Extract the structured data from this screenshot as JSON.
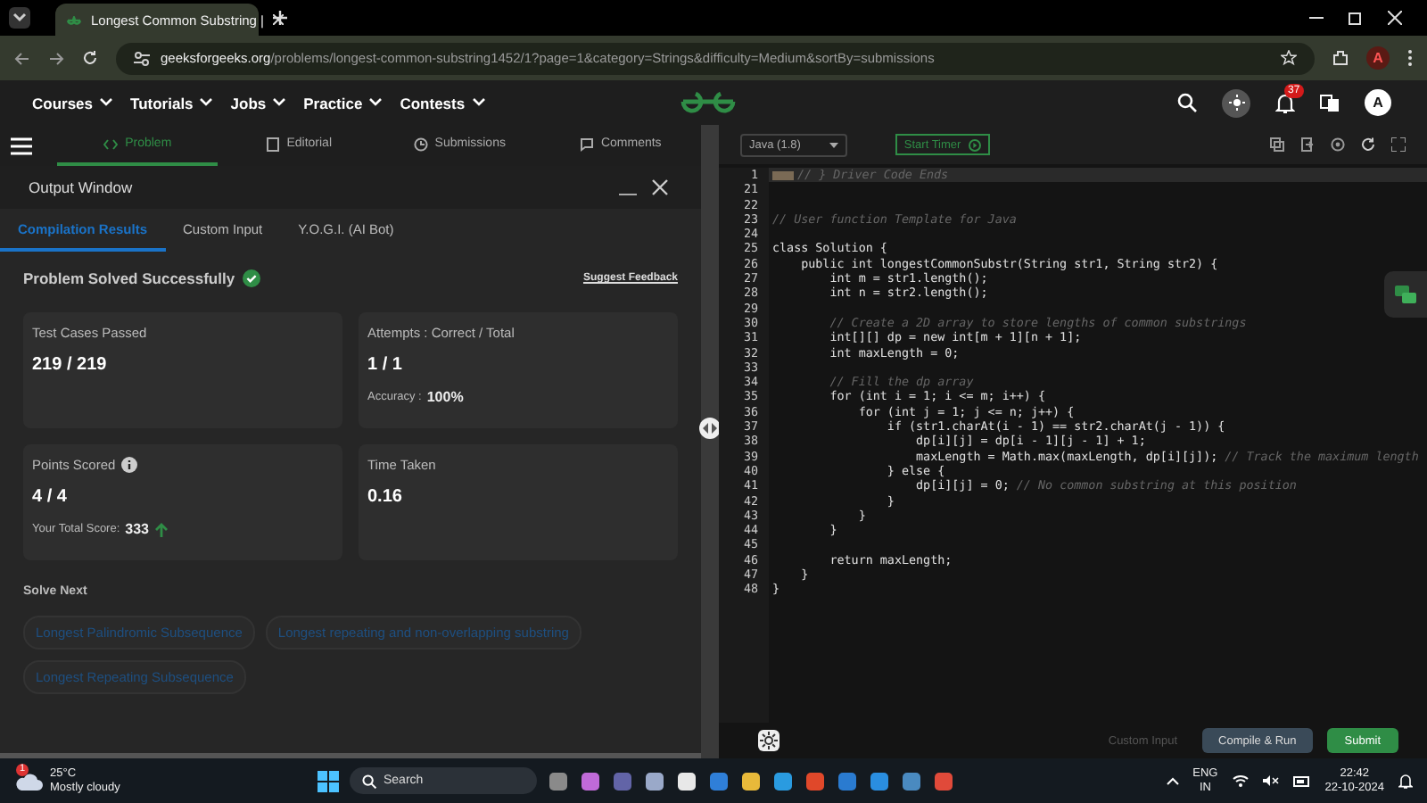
{
  "browser": {
    "tab_title": "Longest Common Substring |",
    "url_domain": "geeksforgeeks.org",
    "url_path": "/problems/longest-common-substring1452/1?page=1&category=Strings&difficulty=Medium&sortBy=submissions",
    "profile": "A"
  },
  "site_nav": {
    "menus": [
      "Courses",
      "Tutorials",
      "Jobs",
      "Practice",
      "Contests"
    ],
    "notification_count": "37",
    "avatar": "A"
  },
  "problem_tabs": [
    {
      "label": "Problem",
      "selected": true
    },
    {
      "label": "Editorial",
      "selected": false
    },
    {
      "label": "Submissions",
      "selected": false
    },
    {
      "label": "Comments",
      "selected": false
    }
  ],
  "output_window": {
    "title": "Output Window",
    "tabs": [
      {
        "label": "Compilation Results",
        "selected": true
      },
      {
        "label": "Custom Input",
        "selected": false
      },
      {
        "label": "Y.O.G.I. (AI Bot)",
        "selected": false
      }
    ],
    "status": "Problem Solved Successfully",
    "feedback_link": "Suggest Feedback",
    "cards": [
      {
        "label": "Test Cases Passed",
        "value": "219 / 219",
        "info": false
      },
      {
        "label": "Attempts : Correct / Total",
        "value": "1 / 1",
        "extra_label": "Accuracy :",
        "extra_value": "100%",
        "info": false
      },
      {
        "label": "Points Scored",
        "value": "4 / 4",
        "extra_label": "Your Total Score:",
        "extra_value": "333",
        "info": true,
        "trend_up": true
      },
      {
        "label": "Time Taken",
        "value": "0.16",
        "info": false
      }
    ],
    "solve_next_title": "Solve Next",
    "solve_next": [
      "Longest Palindromic Subsequence",
      "Longest repeating and non-overlapping substring",
      "Longest Repeating Subsequence"
    ]
  },
  "editor": {
    "language": "Java (1.8)",
    "timer_button": "Start Timer",
    "lines": [
      {
        "num": "1",
        "comment": "// } Driver Code Ends",
        "folded": true
      },
      {
        "num": "21"
      },
      {
        "num": "22"
      },
      {
        "num": "23",
        "comment": "// User function Template for Java"
      },
      {
        "num": "24"
      },
      {
        "num": "25",
        "code": "class Solution {"
      },
      {
        "num": "26",
        "code": "    public int longestCommonSubstr(String str1, String str2) {"
      },
      {
        "num": "27",
        "code": "        int m = str1.length();"
      },
      {
        "num": "28",
        "code": "        int n = str2.length();"
      },
      {
        "num": "29"
      },
      {
        "num": "30",
        "comment": "        // Create a 2D array to store lengths of common substrings"
      },
      {
        "num": "31",
        "code": "        int[][] dp = new int[m + 1][n + 1];"
      },
      {
        "num": "32",
        "code": "        int maxLength = 0;"
      },
      {
        "num": "33"
      },
      {
        "num": "34",
        "comment": "        // Fill the dp array"
      },
      {
        "num": "35",
        "code": "        for (int i = 1; i <= m; i++) {"
      },
      {
        "num": "36",
        "code": "            for (int j = 1; j <= n; j++) {"
      },
      {
        "num": "37",
        "code": "                if (str1.charAt(i - 1) == str2.charAt(j - 1)) {"
      },
      {
        "num": "38",
        "code": "                    dp[i][j] = dp[i - 1][j - 1] + 1;"
      },
      {
        "num": "39",
        "code": "                    maxLength = Math.max(maxLength, dp[i][j]); ",
        "comment": "// Track the maximum length"
      },
      {
        "num": "40",
        "code": "                } else {"
      },
      {
        "num": "41",
        "code": "                    dp[i][j] = 0; ",
        "comment": "// No common substring at this position"
      },
      {
        "num": "42",
        "code": "                }"
      },
      {
        "num": "43",
        "code": "            }"
      },
      {
        "num": "44",
        "code": "        }"
      },
      {
        "num": "45"
      },
      {
        "num": "46",
        "code": "        return maxLength;"
      },
      {
        "num": "47",
        "code": "    }"
      },
      {
        "num": "48",
        "code": "}"
      }
    ],
    "custom_input": "Custom Input",
    "compile_button": "Compile & Run",
    "submit_button": "Submit"
  },
  "taskbar": {
    "temperature": "25°C",
    "weather": "Mostly cloudy",
    "weather_badge": "1",
    "search_placeholder": "Search",
    "language": "ENG",
    "region": "IN",
    "time": "22:42",
    "date": "22-10-2024"
  }
}
